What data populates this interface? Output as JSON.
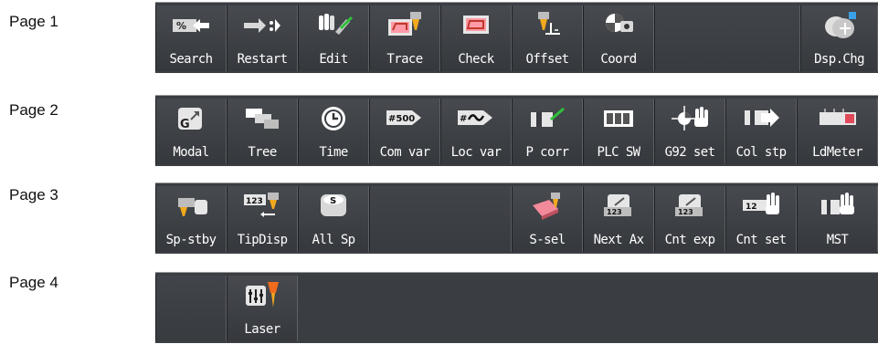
{
  "rows": [
    {
      "label": "Page 1",
      "buttons": [
        {
          "label": "Search",
          "icon": "search-arrows-icon"
        },
        {
          "label": "Restart",
          "icon": "restart-arrow-icon"
        },
        {
          "label": "Edit",
          "icon": "edit-hand-icon"
        },
        {
          "label": "Trace",
          "icon": "trace-tool-icon"
        },
        {
          "label": "Check",
          "icon": "check-display-icon"
        },
        {
          "label": "Offset",
          "icon": "tool-offset-icon"
        },
        {
          "label": "Coord",
          "icon": "coordinate-icon"
        },
        {
          "label": "",
          "icon": ""
        },
        {
          "label": "Dsp.Chg",
          "icon": "display-change-icon"
        }
      ]
    },
    {
      "label": "Page 2",
      "buttons": [
        {
          "label": "Modal",
          "icon": "modal-g-icon"
        },
        {
          "label": "Tree",
          "icon": "tree-windows-icon"
        },
        {
          "label": "Time",
          "icon": "clock-icon"
        },
        {
          "label": "Com var",
          "icon": "common-variable-icon"
        },
        {
          "label": "Loc var",
          "icon": "local-variable-icon"
        },
        {
          "label": "P corr",
          "icon": "p-correction-icon"
        },
        {
          "label": "PLC SW",
          "icon": "plc-switch-icon"
        },
        {
          "label": "G92 set",
          "icon": "g92-set-icon"
        },
        {
          "label": "Col stp",
          "icon": "collet-stop-icon"
        },
        {
          "label": "LdMeter",
          "icon": "load-meter-icon"
        }
      ]
    },
    {
      "label": "Page 3",
      "buttons": [
        {
          "label": "Sp-stby",
          "icon": "spindle-standby-icon"
        },
        {
          "label": "TipDisp",
          "icon": "tip-display-icon"
        },
        {
          "label": "All Sp",
          "icon": "all-spindle-icon"
        },
        {
          "label": "",
          "icon": ""
        },
        {
          "label": "",
          "icon": ""
        },
        {
          "label": "S-sel",
          "icon": "spindle-select-icon"
        },
        {
          "label": "Next Ax",
          "icon": "next-axis-icon"
        },
        {
          "label": "Cnt exp",
          "icon": "counter-expand-icon"
        },
        {
          "label": "Cnt set",
          "icon": "counter-set-icon"
        },
        {
          "label": "MST",
          "icon": "mst-hand-icon"
        }
      ]
    },
    {
      "label": "Page 4",
      "buttons": [
        {
          "label": "",
          "icon": ""
        },
        {
          "label": "Laser",
          "icon": "laser-settings-icon"
        }
      ]
    }
  ]
}
